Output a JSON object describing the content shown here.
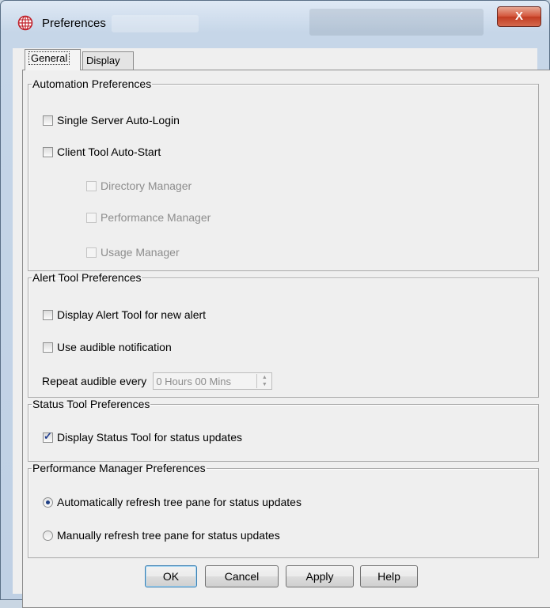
{
  "window": {
    "title": "Preferences",
    "close_label": "X"
  },
  "tabs": [
    {
      "label": "General",
      "selected": true
    },
    {
      "label": "Display",
      "selected": false
    }
  ],
  "automation": {
    "legend": "Automation Preferences",
    "single_server": {
      "label": "Single Server Auto-Login",
      "checked": false
    },
    "client_tool": {
      "label": "Client Tool Auto-Start",
      "checked": false
    },
    "directory_manager": {
      "label": "Directory Manager",
      "checked": false,
      "enabled": false
    },
    "performance_manager": {
      "label": "Performance Manager",
      "checked": false,
      "enabled": false
    },
    "usage_manager": {
      "label": "Usage Manager",
      "checked": false,
      "enabled": false
    }
  },
  "alert": {
    "legend": "Alert Tool Preferences",
    "display_alert": {
      "label": "Display Alert Tool for new alert",
      "checked": false
    },
    "audible": {
      "label": "Use audible notification",
      "checked": false
    },
    "repeat_label": "Repeat audible every",
    "repeat_value": "0 Hours 00 Mins"
  },
  "status": {
    "legend": "Status Tool Preferences",
    "display_status": {
      "label": "Display Status Tool for status updates",
      "checked": true
    }
  },
  "performance": {
    "legend": "Performance Manager Preferences",
    "auto_refresh": {
      "label": "Automatically refresh tree pane for status updates",
      "selected": true
    },
    "manual_refresh": {
      "label": "Manually refresh tree pane for status updates",
      "selected": false
    }
  },
  "buttons": {
    "ok": "OK",
    "cancel": "Cancel",
    "apply": "Apply",
    "help": "Help"
  },
  "colors": {
    "accent": "#1f3f86",
    "close_button": "#c23b22"
  },
  "icons": {
    "app": "globe-grid-icon",
    "close": "close-icon"
  }
}
